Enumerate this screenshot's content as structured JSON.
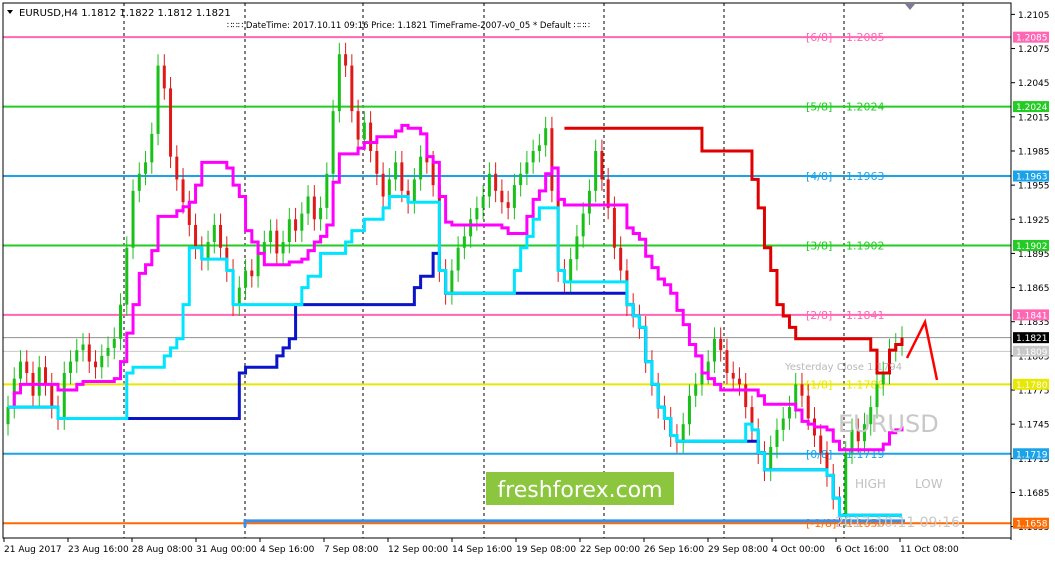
{
  "header": {
    "symbol_info": "EURUSD,H4  1.1812 1.1822 1.1812 1.1821",
    "info_line": "∷∷∷ DateTime: 2017.10.11 09:16    Price: 1.1821    TimeFrame-2007-v0_05    *   Default    ∷∷∷"
  },
  "watermark": {
    "symbol": "EURUSD",
    "brand": "freshforex.com",
    "timestamp": "2017.10.11 09:16",
    "high_label": "HIGH",
    "low_label": "LOW",
    "yesterday_close": "Yesterday Close 1.1794"
  },
  "colors": {
    "bull": "#18c018",
    "bear": "#e01818",
    "ma_fast": "#ff00ff",
    "ma_cyan": "#00e5ff",
    "ma_blue": "#0a14c8",
    "ma_red": "#e00000",
    "brand_bg": "#8cc63f"
  },
  "chart_data": {
    "type": "line",
    "title": "EURUSD,H4",
    "ylim": [
      1.1645,
      1.2115
    ],
    "x_tick_labels": [
      "21 Aug 2017",
      "23 Aug 16:00",
      "28 Aug 08:00",
      "31 Aug 00:00",
      "4 Sep 16:00",
      "7 Sep 08:00",
      "12 Sep 00:00",
      "14 Sep 16:00",
      "19 Sep 08:00",
      "22 Sep 00:00",
      "26 Sep 16:00",
      "29 Sep 08:00",
      "4 Oct 00:00",
      "6 Oct 16:00",
      "11 Oct 08:00"
    ],
    "y_ticks": [
      1.2105,
      1.2075,
      1.2045,
      1.2015,
      1.1985,
      1.1955,
      1.1925,
      1.1895,
      1.1865,
      1.1835,
      1.1805,
      1.1775,
      1.1745,
      1.1715,
      1.1685,
      1.1655
    ],
    "murrey_levels": [
      {
        "label": "[6/8]",
        "value": 1.2085,
        "color": "#ff66b3"
      },
      {
        "label": "[5/8]",
        "value": 1.2024,
        "color": "#22cc22"
      },
      {
        "label": "[4/8]",
        "value": 1.1963,
        "color": "#1aa3e8"
      },
      {
        "label": "[3/8]",
        "value": 1.1902,
        "color": "#22cc22"
      },
      {
        "label": "[2/8]",
        "value": 1.1841,
        "color": "#ff66b3"
      },
      {
        "label": "[1/8]",
        "value": 1.178,
        "color": "#e8e800"
      },
      {
        "label": "[0/8]",
        "value": 1.1719,
        "color": "#1aa3e8"
      },
      {
        "label": "[-1/8]",
        "value": 1.1658,
        "color": "#ff6a00"
      }
    ],
    "current_price": "1.1821",
    "yesterday_close_price": "1.1809",
    "close_series": [
      1.176,
      1.1785,
      1.18,
      1.179,
      1.177,
      1.1795,
      1.178,
      1.176,
      1.175,
      1.179,
      1.18,
      1.181,
      1.1815,
      1.18,
      1.1795,
      1.1805,
      1.1812,
      1.182,
      1.185,
      1.19,
      1.195,
      1.1965,
      1.1975,
      1.2,
      1.206,
      1.204,
      1.198,
      1.196,
      1.194,
      1.192,
      1.19,
      1.189,
      1.1905,
      1.192,
      1.19,
      1.188,
      1.185,
      1.1865,
      1.188,
      1.1875,
      1.1895,
      1.1905,
      1.1915,
      1.1895,
      1.1905,
      1.1925,
      1.1915,
      1.193,
      1.1945,
      1.1925,
      1.1935,
      1.1965,
      1.202,
      1.207,
      1.206,
      1.202,
      1.1995,
      1.201,
      1.1985,
      1.1965,
      1.1945,
      1.196,
      1.1975,
      1.195,
      1.194,
      1.196,
      1.198,
      1.1975,
      1.1955,
      1.188,
      1.186,
      1.188,
      1.19,
      1.191,
      1.1925,
      1.1935,
      1.1945,
      1.1965,
      1.195,
      1.194,
      1.1935,
      1.1955,
      1.1965,
      1.1975,
      1.1985,
      1.199,
      1.2005,
      1.195,
      1.188,
      1.187,
      1.189,
      1.191,
      1.193,
      1.195,
      1.1985,
      1.196,
      1.1935,
      1.19,
      1.188,
      1.185,
      1.184,
      1.183,
      1.18,
      1.178,
      1.176,
      1.175,
      1.1735,
      1.173,
      1.1745,
      1.177,
      1.178,
      1.179,
      1.18,
      1.182,
      1.181,
      1.179,
      1.1785,
      1.178,
      1.176,
      1.174,
      1.172,
      1.1705,
      1.1725,
      1.174,
      1.175,
      1.176,
      1.178,
      1.177,
      1.175,
      1.1735,
      1.172,
      1.17,
      1.168,
      1.1665,
      1.172,
      1.174,
      1.173,
      1.1745,
      1.176,
      1.178,
      1.179,
      1.181,
      1.1815,
      1.1821
    ]
  }
}
